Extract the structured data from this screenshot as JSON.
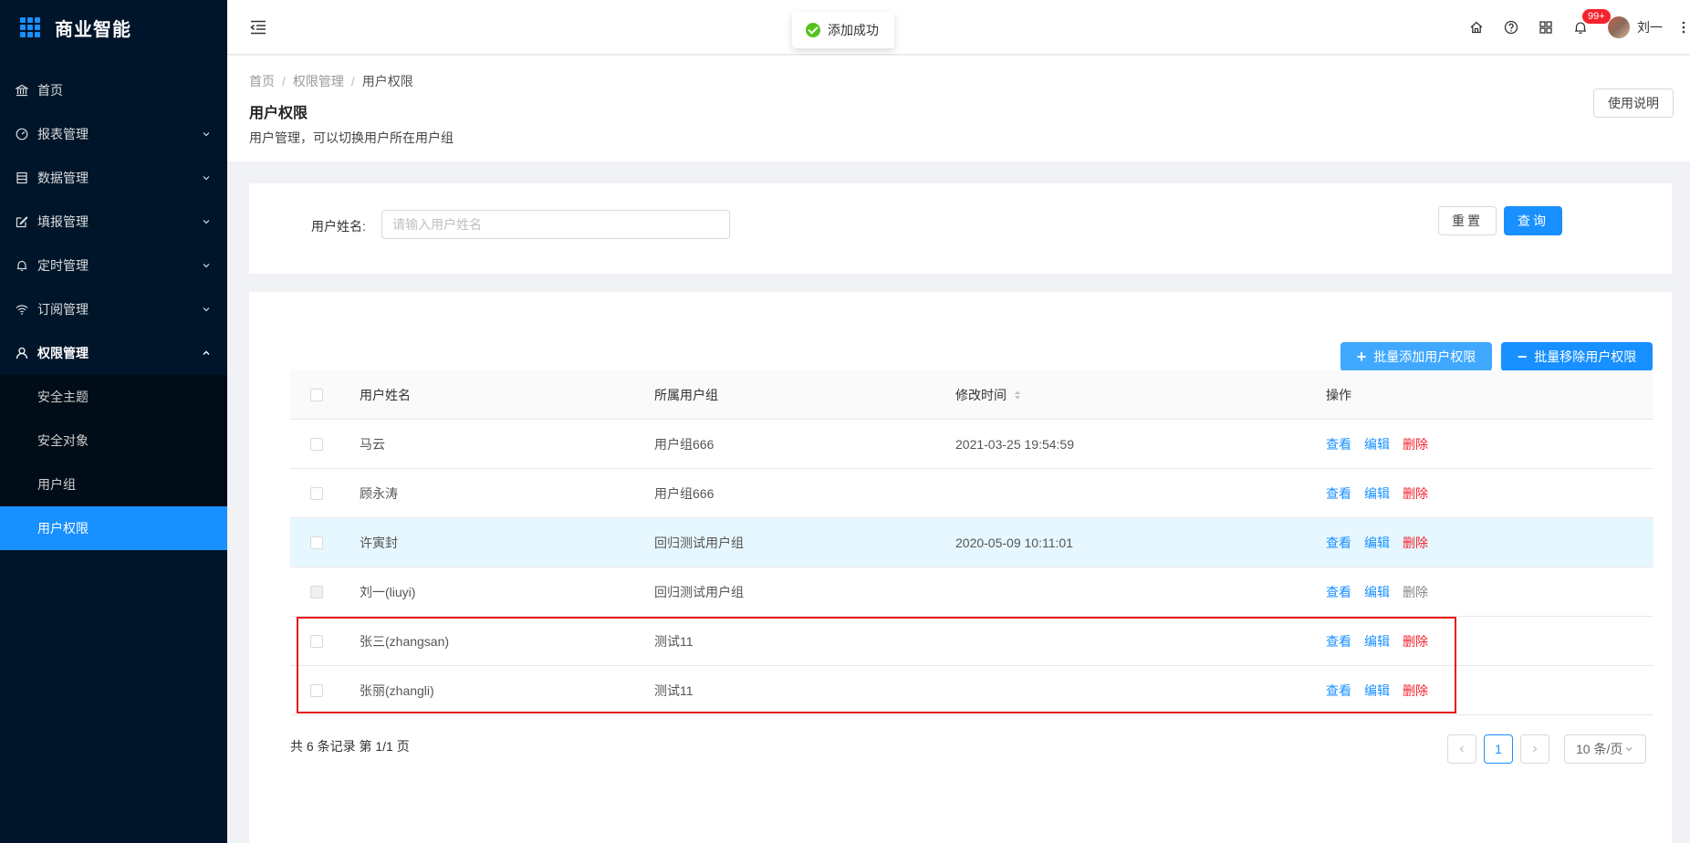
{
  "app": {
    "title": "商业智能"
  },
  "sidebar": {
    "items": [
      {
        "label": "首页",
        "icon": "bank-icon"
      },
      {
        "label": "报表管理",
        "icon": "dashboard-icon"
      },
      {
        "label": "数据管理",
        "icon": "database-icon"
      },
      {
        "label": "填报管理",
        "icon": "form-icon"
      },
      {
        "label": "定时管理",
        "icon": "bell-icon"
      },
      {
        "label": "订阅管理",
        "icon": "wifi-icon"
      },
      {
        "label": "权限管理",
        "icon": "user-icon"
      }
    ],
    "submenu": [
      {
        "label": "安全主题"
      },
      {
        "label": "安全对象"
      },
      {
        "label": "用户组"
      },
      {
        "label": "用户权限"
      }
    ]
  },
  "toast": {
    "message": "添加成功"
  },
  "header": {
    "badge": "99+",
    "username": "刘一"
  },
  "page": {
    "breadcrumb": [
      "首页",
      "权限管理",
      "用户权限"
    ],
    "title": "用户权限",
    "description": "用户管理，可以切换用户所在用户组",
    "help_label": "使用说明"
  },
  "search": {
    "label": "用户姓名:",
    "placeholder": "请输入用户姓名",
    "reset_label": "重置",
    "query_label": "查询"
  },
  "toolbar": {
    "batch_add_label": "批量添加用户权限",
    "batch_remove_label": "批量移除用户权限"
  },
  "table": {
    "columns": [
      "用户姓名",
      "所属用户组",
      "修改时间",
      "操作"
    ],
    "ops": {
      "view": "查看",
      "edit": "编辑",
      "delete": "删除"
    },
    "rows": [
      {
        "name": "马云",
        "group": "用户组666",
        "time": "2021-03-25 19:54:59"
      },
      {
        "name": "顾永涛",
        "group": "用户组666",
        "time": ""
      },
      {
        "name": "许寅封",
        "group": "回归测试用户组",
        "time": "2020-05-09 10:11:01"
      },
      {
        "name": "刘一(liuyi)",
        "group": "回归测试用户组",
        "time": ""
      },
      {
        "name": "张三(zhangsan)",
        "group": "测试11",
        "time": ""
      },
      {
        "name": "张丽(zhangli)",
        "group": "测试11",
        "time": ""
      }
    ]
  },
  "pagination": {
    "summary": "共 6 条记录 第 1/1 页",
    "current": "1",
    "page_size": "10 条/页"
  }
}
